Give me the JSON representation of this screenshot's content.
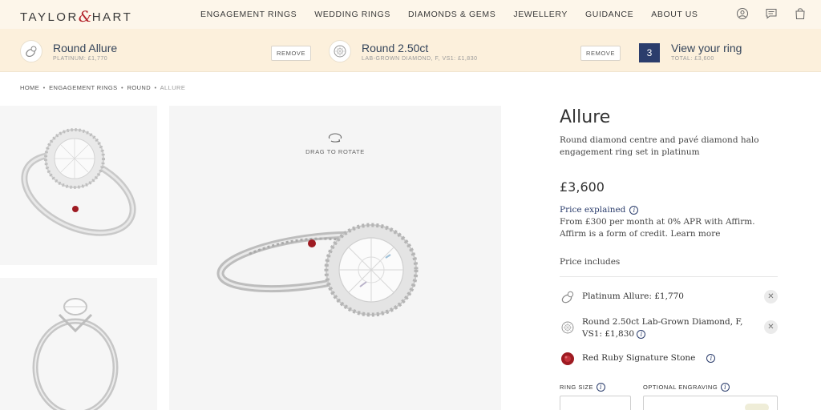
{
  "brand": {
    "name_left": "TAYLOR",
    "name_amp": "&",
    "name_right": "HART"
  },
  "nav": {
    "links": [
      "ENGAGEMENT RINGS",
      "WEDDING RINGS",
      "DIAMONDS & GEMS",
      "JEWELLERY",
      "GUIDANCE",
      "ABOUT US"
    ],
    "icons": [
      "account-icon",
      "chat-icon",
      "bag-icon"
    ]
  },
  "builder": {
    "setting": {
      "title": "Round Allure",
      "subtitle": "PLATINUM: £1,770",
      "remove_label": "REMOVE"
    },
    "diamond": {
      "title": "Round 2.50ct",
      "subtitle": "LAB-GROWN DIAMOND, F, VS1: £1,830",
      "remove_label": "REMOVE"
    },
    "summary": {
      "count": "3",
      "title": "View your ring",
      "subtitle": "TOTAL: £3,600"
    }
  },
  "breadcrumb": {
    "items": [
      "HOME",
      "ENGAGEMENT RINGS",
      "ROUND"
    ],
    "current": "ALLURE",
    "separator": "•"
  },
  "viewer": {
    "hint": "DRAG TO ROTATE"
  },
  "product": {
    "title": "Allure",
    "description": "Round diamond centre and pavé diamond halo engagement ring set in platinum",
    "price": "£3,600",
    "price_explained": "Price explained",
    "finance": "From £300 per month at 0% APR with Affirm. Affirm is a form of credit. Learn more",
    "includes_heading": "Price includes",
    "includes": [
      {
        "icon": "ring-setting-icon",
        "text": "Platinum Allure: £1,770",
        "removable": true
      },
      {
        "icon": "diamond-icon",
        "text": "Round 2.50ct Lab-Grown Diamond, F, VS1: £1,830",
        "removable": true
      },
      {
        "icon": "ruby-icon",
        "text": "Red Ruby Signature Stone",
        "removable": false
      }
    ],
    "ring_size_label": "RING SIZE",
    "engraving_label": "OPTIONAL ENGRAVING"
  },
  "colors": {
    "navy": "#2b3d6c",
    "cream": "#fcf0dc",
    "ruby": "#9e1b22",
    "logo_amp": "#b3222b"
  }
}
